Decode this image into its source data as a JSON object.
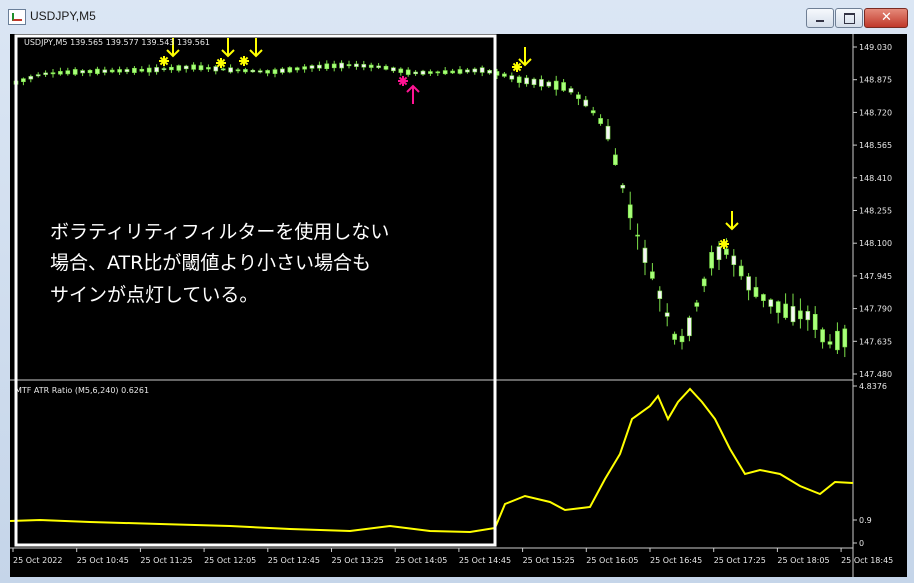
{
  "window": {
    "title": "USDJPY,M5"
  },
  "price_panel": {
    "header": "USDJPY,M5  139.565 139.577 139.543 139.561",
    "y_ticks": [
      "149.030",
      "148.875",
      "148.720",
      "148.565",
      "148.410",
      "148.255",
      "148.100",
      "147.945",
      "147.790",
      "147.635",
      "147.480"
    ]
  },
  "atr_panel": {
    "header": "MTF ATR Ratio  (M5,6,240) 0.6261",
    "y_ticks": [
      "4.8376",
      "0.9",
      "0"
    ]
  },
  "x_ticks": [
    "25 Oct 2022",
    "25 Oct 10:45",
    "25 Oct 11:25",
    "25 Oct 12:05",
    "25 Oct 12:45",
    "25 Oct 13:25",
    "25 Oct 14:05",
    "25 Oct 14:45",
    "25 Oct 15:25",
    "25 Oct 16:05",
    "25 Oct 16:45",
    "25 Oct 17:25",
    "25 Oct 18:05",
    "25 Oct 18:45"
  ],
  "annotation": {
    "lines": [
      "ボラティリティフィルターを使用しない",
      "場合、ATR比が閾値より小さい場合も",
      "サインが点灯している。"
    ]
  },
  "colors": {
    "background": "#000000",
    "bull_candle": "#f5f5f5",
    "bear_candle": "#a8ff7a",
    "wick": "#7ce04a",
    "atr_line": "#ffff00",
    "sell_signal": "#ffff00",
    "buy_signal": "#ff1493",
    "highlight_box": "#ffffff"
  }
}
